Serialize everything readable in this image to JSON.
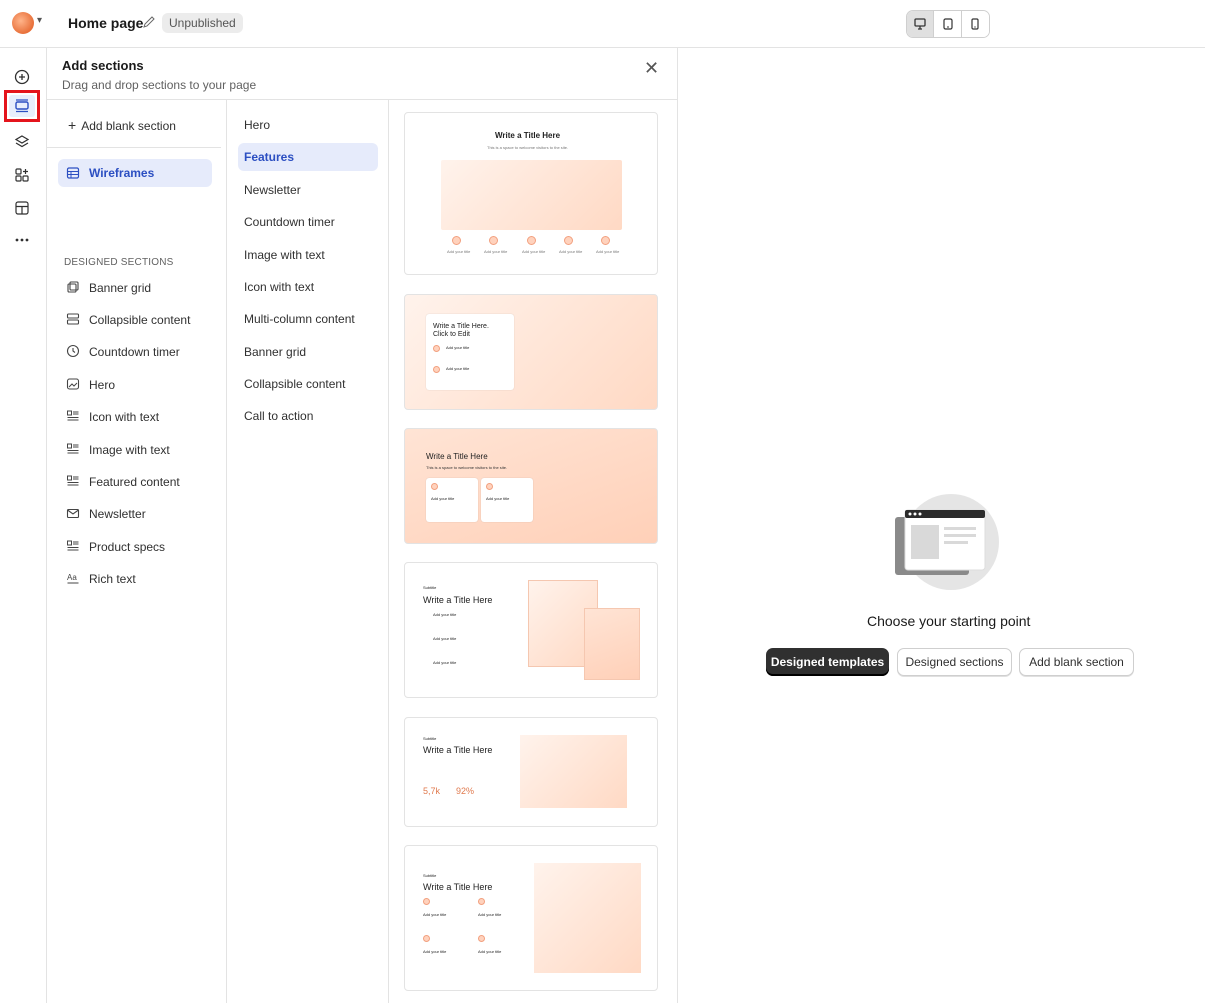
{
  "header": {
    "page_title": "Home page",
    "status_badge": "Unpublished",
    "devices": [
      "desktop",
      "tablet",
      "mobile"
    ]
  },
  "rail": {
    "icons": [
      "add-circle-icon",
      "sections-icon",
      "layers-icon",
      "apps-icon",
      "layout-icon",
      "more-icon"
    ],
    "selected": "sections-icon"
  },
  "panel": {
    "title": "Add sections",
    "subtitle": "Drag and drop sections to your page",
    "add_blank": "Add blank section",
    "wireframes": "Wireframes",
    "designed_heading": "DESIGNED SECTIONS",
    "designed_sections": [
      "Banner grid",
      "Collapsible content",
      "Countdown timer",
      "Hero",
      "Icon with text",
      "Image with text",
      "Featured content",
      "Newsletter",
      "Product specs",
      "Rich text"
    ],
    "categories": [
      "Hero",
      "Features",
      "Newsletter",
      "Countdown timer",
      "Image with text",
      "Icon with text",
      "Multi-column content",
      "Banner grid",
      "Collapsible content",
      "Call to action"
    ],
    "active_category": "Features"
  },
  "templates": {
    "t1": {
      "title": "Write a Title Here",
      "subtitle": "This is a space to welcome visitors to the site.",
      "items": [
        "Add your title",
        "Add your title",
        "Add your title",
        "Add your title",
        "Add your title"
      ]
    },
    "t2": {
      "title": "Write a Title Here.",
      "title2": "Click to Edit",
      "item1": "Add your title",
      "item2": "Add your title"
    },
    "t3": {
      "title": "Write a Title Here",
      "subtitle": "This is a space to welcome visitors to the site.",
      "item1": "Add your title",
      "item2": "Add your title"
    },
    "t4": {
      "eyebrow": "Subtitle",
      "title": "Write a Title Here",
      "items": [
        "Add your title",
        "Add your title",
        "Add your title"
      ]
    },
    "t5": {
      "eyebrow": "Subtitle",
      "title": "Write a Title Here",
      "stat1": "5,7k",
      "stat2": "92%"
    },
    "t6": {
      "eyebrow": "Subtitle",
      "title": "Write a Title Here",
      "items": [
        "Add your title",
        "Add your title",
        "Add your title",
        "Add your title"
      ]
    }
  },
  "preview": {
    "prompt": "Choose your starting point",
    "btn_templates": "Designed templates",
    "btn_sections": "Designed sections",
    "btn_blank": "Add blank section"
  }
}
